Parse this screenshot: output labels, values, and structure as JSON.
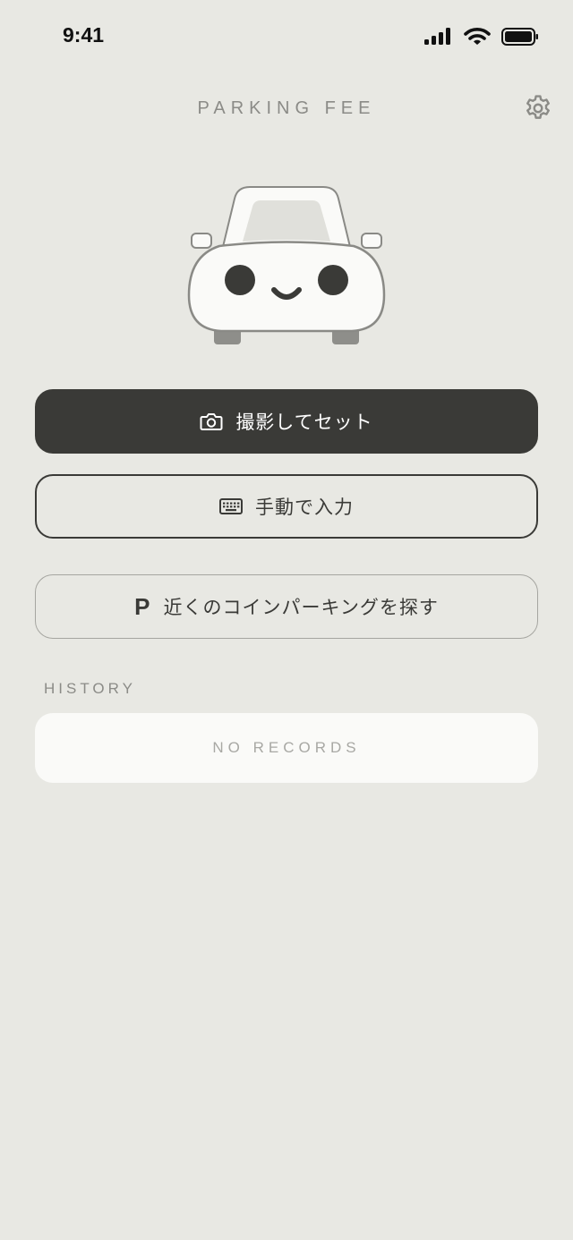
{
  "status_bar": {
    "time": "9:41",
    "icons": [
      "signal-icon",
      "wifi-icon",
      "battery-icon"
    ]
  },
  "header": {
    "title": "PARKING FEE",
    "settings_icon": "gear-icon"
  },
  "hero": {
    "illustration": "smiling-car-icon"
  },
  "actions": {
    "camera_label": "撮影してセット",
    "camera_icon": "camera-icon",
    "manual_label": "手動で入力",
    "manual_icon": "keyboard-icon",
    "parking_label": "近くのコインパーキングを探す",
    "parking_icon": "P"
  },
  "history": {
    "label": "HISTORY",
    "empty_text": "NO RECORDS"
  },
  "colors": {
    "background": "#e8e8e3",
    "primary": "#3a3a37",
    "muted": "#8b8b87",
    "card": "#fafaf8"
  }
}
